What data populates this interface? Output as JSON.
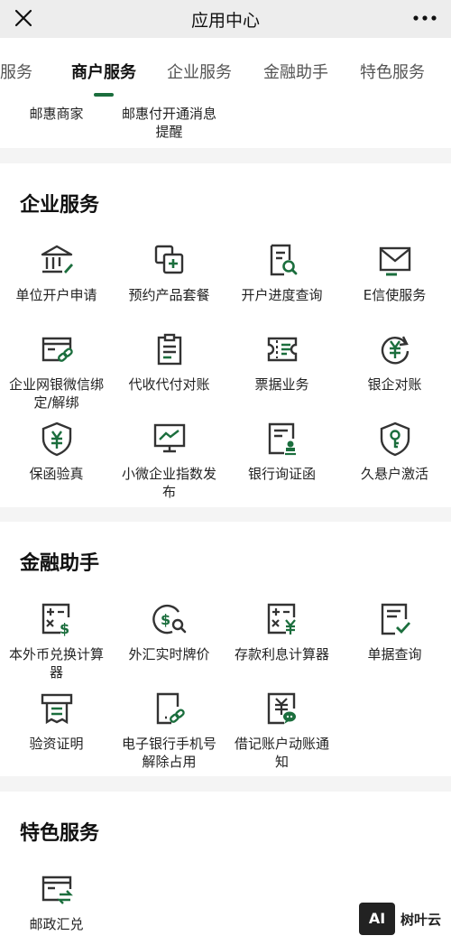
{
  "header": {
    "title": "应用中心"
  },
  "tabs": [
    "活服务",
    "商户服务",
    "企业服务",
    "金融助手",
    "特色服务"
  ],
  "merchant": {
    "items": [
      "邮惠商家",
      "邮惠付开通消息提醒"
    ]
  },
  "enterprise": {
    "title": "企业服务",
    "items": [
      "单位开户申请",
      "预约产品套餐",
      "开户进度查询",
      "E信使服务",
      "企业网银微信绑定/解绑",
      "代收代付对账",
      "票据业务",
      "银企对账",
      "保函验真",
      "小微企业指数发布",
      "银行询证函",
      "久悬户激活"
    ]
  },
  "finance": {
    "title": "金融助手",
    "items": [
      "本外币兑换计算器",
      "外汇实时牌价",
      "存款利息计算器",
      "单据查询",
      "验资证明",
      "电子银行手机号解除占用",
      "借记账户动账通知"
    ]
  },
  "special": {
    "title": "特色服务",
    "items": [
      "邮政汇兑"
    ]
  },
  "watermark": {
    "text": "树叶云"
  },
  "colors": {
    "accent": "#1b6e3d",
    "icon": "#333333"
  }
}
